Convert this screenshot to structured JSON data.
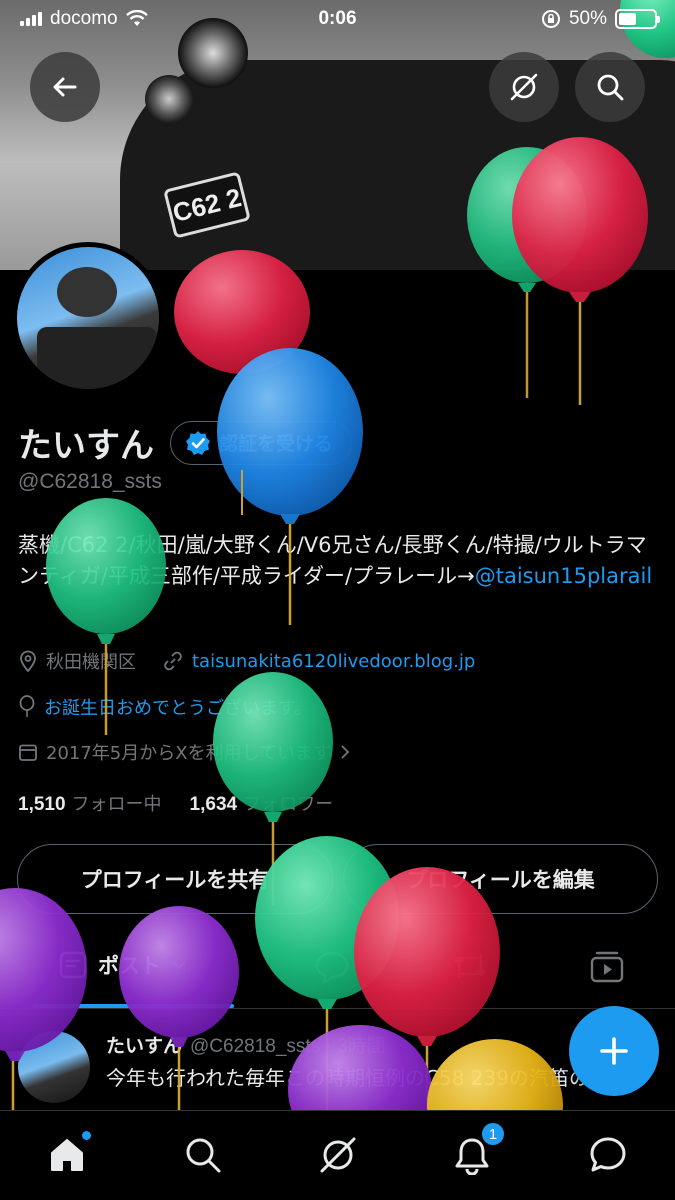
{
  "status_bar": {
    "carrier": "docomo",
    "time": "0:06",
    "battery": "50%",
    "battery_level": 0.5
  },
  "banner": {
    "plate_text": "C62 2"
  },
  "profile": {
    "display_name": "たいすん",
    "verify_label": "認証を受ける",
    "handle": "@C62818_ssts",
    "bio_text": "蒸機/C62 2/秋田/嵐/大野くん/V6兄さん/長野くん/特撮/ウルトラマンティガ/平成三部作/平成ライダー/プラレール→",
    "bio_link": "@taisun15plarail",
    "location": "秋田機関区",
    "website": "taisunakita6120livedoor.blog.jp",
    "birthday": "お誕生日おめでとうございます。",
    "joined": "2017年5月からXを利用しています",
    "following_count": "1,510",
    "following_label": "フォロー中",
    "followers_count": "1,634",
    "followers_label": "フォロワー"
  },
  "actions": {
    "share_label": "プロフィールを共有",
    "edit_label": "プロフィールを編集"
  },
  "tabs": {
    "posts_label": "ポスト"
  },
  "post": {
    "name": "たいすん",
    "meta": "@C62818_ssts · 3時間",
    "text": "今年も行われた毎年この時期恒例のC58 239の汽笛の時報"
  },
  "nav": {
    "notification_count": "1"
  },
  "colors": {
    "accent": "#1d9bf0",
    "background": "#000000",
    "text_primary": "#e7e9ea",
    "text_secondary": "#71767b",
    "border": "#2f3336"
  }
}
